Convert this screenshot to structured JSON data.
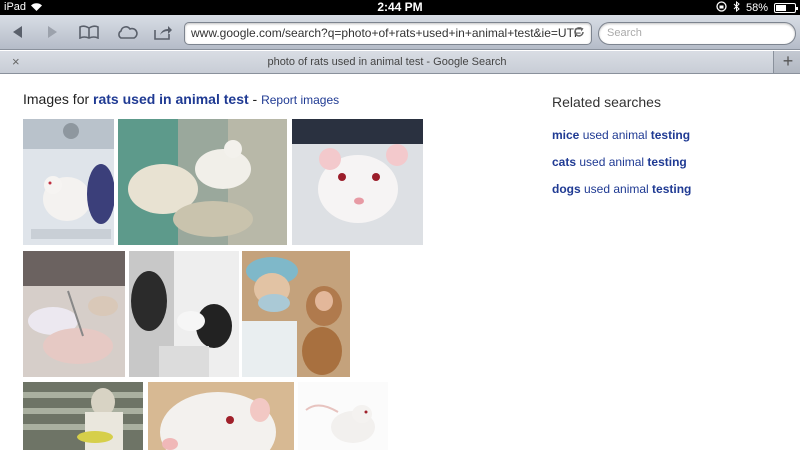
{
  "status_bar": {
    "carrier": "iPad",
    "time": "2:44 PM",
    "battery": "58%",
    "battery_level": 0.58
  },
  "toolbar": {
    "url": "www.google.com/search?q=photo+of+rats+used+in+animal+test&ie=UTF",
    "search_placeholder": "Search"
  },
  "tab": {
    "title": "photo of rats used in animal test - Google Search",
    "close": "×",
    "new_tab": "+"
  },
  "results": {
    "heading_prefix": "Images for ",
    "query": "rats used in animal test",
    "separator": " - ",
    "report": "Report images"
  },
  "related": {
    "title": "Related searches",
    "items": [
      {
        "bold": "mice",
        "middle": " used animal ",
        "bold2": "testing"
      },
      {
        "bold": "cats",
        "middle": " used animal ",
        "bold2": "testing"
      },
      {
        "bold": "dogs",
        "middle": " used animal ",
        "bold2": "testing"
      }
    ]
  },
  "images": [
    "rat-on-scale-photo",
    "rat-held-by-gloved-hand-photo",
    "white-rat-closeup-photo",
    "rat-dissection-photo",
    "lab-worker-black-gloves-photo",
    "researcher-with-monkey-photo",
    "lab-worker-with-cages-photo",
    "white-rat-face-photo",
    "white-rat-standing-photo"
  ]
}
